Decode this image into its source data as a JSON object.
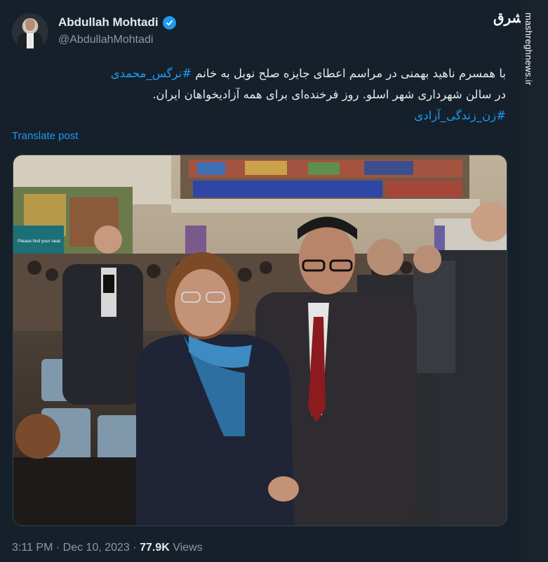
{
  "author": {
    "display_name": "Abdullah Mohtadi",
    "handle": "@AbdullahMohtadi",
    "verified": true
  },
  "watermark": {
    "logo_text": "مشرق",
    "side_text": "mashreghnews.ir"
  },
  "tweet": {
    "line1_text": "با همسرم ناهید بهمنی در مراسم اعطای جایزه صلح نوبل به خانم",
    "line1_hashtag": "#نرگس_محمدی",
    "line2_text": "در سالن شهرداری شهر اسلو. روز فرخنده‌ای برای همه آزادیخواهان ایران.",
    "line3_hashtag": "#زن_زندگی_آزادی",
    "translate_label": "Translate post"
  },
  "photo": {
    "screen_text": "Please find your seat.",
    "description_colors": {
      "hall_wall": "#b7aa96",
      "mural": "#3d5fb0"
    }
  },
  "meta": {
    "time": "3:11 PM",
    "separator": "·",
    "date": "Dec 10, 2023",
    "views_count": "77.9K",
    "views_label": "Views"
  },
  "colors": {
    "background": "#15202b",
    "text_primary": "#e7e9ea",
    "text_secondary": "#8b98a5",
    "accent": "#1d9bf0"
  }
}
